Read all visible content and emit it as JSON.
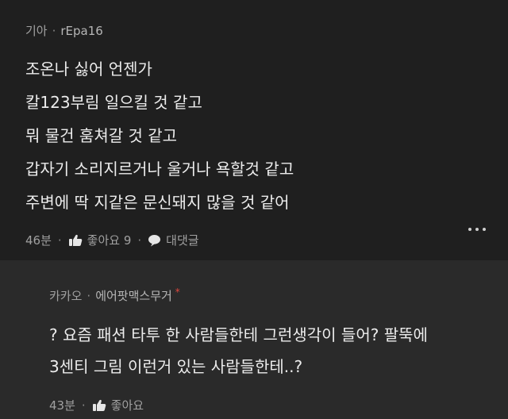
{
  "comments": [
    {
      "author_prefix": "기아",
      "author": "rEpa16",
      "lines": [
        "조온나 싫어 언젠가",
        "칼123부림 일으킬 것 같고",
        "뭐 물건 훔쳐갈 것 같고",
        "갑자기 소리지르거나 울거나 욕할것 같고",
        "주변에 딱 지같은 문신돼지 많을 것 같어"
      ],
      "time": "46분",
      "like_label": "좋아요 9",
      "reply_label": "대댓글",
      "like_icon": "thumbs-up-icon",
      "reply_icon": "speech-bubble-icon",
      "more_icon": "more-options-icon"
    },
    {
      "author_prefix": "카카오",
      "author": "에어팟맥스무거",
      "badge": "*",
      "lines": [
        "? 요즘 패션 타투 한 사람들한테 그런생각이 들어? 팔뚝에",
        "3센티 그림 이런거 있는 사람들한테..?"
      ],
      "time": "43분",
      "like_label": "좋아요",
      "like_icon": "thumbs-up-icon"
    }
  ],
  "colors": {
    "background": "#1f1f1f",
    "reply_background": "#2a2a2a",
    "text": "#ececec",
    "muted": "#a0a0a0",
    "badge": "#e0483e"
  }
}
